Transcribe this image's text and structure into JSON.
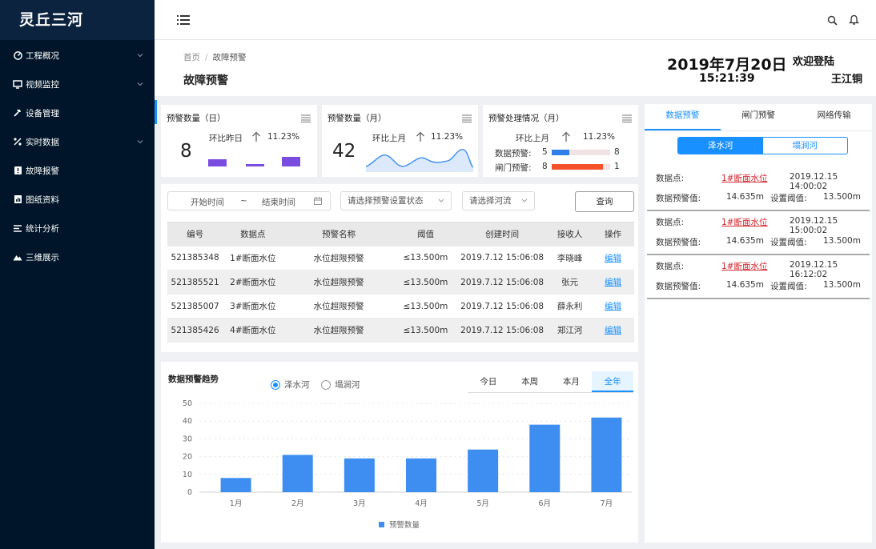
{
  "app": {
    "title": "灵丘三河"
  },
  "sidebar": {
    "items": [
      {
        "label": "工程概况",
        "icon": "gauge-icon",
        "expandable": true
      },
      {
        "label": "视频监控",
        "icon": "monitor-icon",
        "expandable": true
      },
      {
        "label": "设备管理",
        "icon": "hammer-icon",
        "expandable": false
      },
      {
        "label": "实时数据",
        "icon": "percent-icon",
        "expandable": true
      },
      {
        "label": "故障报警",
        "icon": "alert-icon",
        "expandable": false
      },
      {
        "label": "图纸资料",
        "icon": "chart-doc-icon",
        "expandable": false
      },
      {
        "label": "统计分析",
        "icon": "list-icon",
        "expandable": false
      },
      {
        "label": "三维展示",
        "icon": "mountain-icon",
        "expandable": false
      }
    ]
  },
  "breadcrumb": {
    "home": "首页",
    "sep": "/",
    "current": "故障预警"
  },
  "page_title": "故障预警",
  "header_info": {
    "date": "2019年7月20日",
    "time": "15:21:39",
    "welcome": "欢迎登陆",
    "username": "王江铜"
  },
  "cards": {
    "daily": {
      "title": "预警数量（日）",
      "value": "8",
      "compare_label": "环比昨日",
      "pct": "11.23%"
    },
    "monthly": {
      "title": "预警数量（月）",
      "value": "42",
      "compare_label": "环比上月",
      "pct": "11.23%"
    },
    "handling": {
      "title": "预警处理情况（月）",
      "compare_label": "环比上月",
      "pct": "11.23%",
      "rows": [
        {
          "label": "数据预警:",
          "left": "5",
          "right": "8",
          "fill": 0.3,
          "color": "#2f7fe8"
        },
        {
          "label": "闸门预警:",
          "left": "8",
          "right": "1",
          "fill": 0.88,
          "color": "#f5512b"
        }
      ]
    }
  },
  "filters": {
    "start": "开始时间",
    "tilde": "~",
    "end": "结束时间",
    "status_placeholder": "请选择预警设置状态",
    "river_placeholder": "请选择河流",
    "query_label": "查询"
  },
  "table": {
    "headers": [
      "编号",
      "数据点",
      "预警名称",
      "阈值",
      "创建时间",
      "接收人",
      "操作"
    ],
    "rows": [
      [
        "521385348",
        "1#断面水位",
        "水位超限预警",
        "≤13.500m",
        "2019.7.12 15:06:08",
        "李晓峰",
        "编辑"
      ],
      [
        "521385521",
        "2#断面水位",
        "水位超限预警",
        "≤13.500m",
        "2019.7.12 15:06:08",
        "张元",
        "编辑"
      ],
      [
        "521385007",
        "3#断面水位",
        "水位超限预警",
        "≤13.500m",
        "2019.7.12 15:06:08",
        "薛永利",
        "编辑"
      ],
      [
        "521385426",
        "4#断面水位",
        "水位超限预警",
        "≤13.500m",
        "2019.7.12 15:06:08",
        "郑江河",
        "编辑"
      ]
    ]
  },
  "trend": {
    "title": "数据预警趋势",
    "radios": [
      "泽水河",
      "塌涧河"
    ],
    "tabs": [
      "今日",
      "本周",
      "本月",
      "全年"
    ],
    "active_tab": 3
  },
  "chart_data": {
    "type": "bar",
    "categories": [
      "1月",
      "2月",
      "3月",
      "4月",
      "5月",
      "6月",
      "7月"
    ],
    "series": [
      {
        "name": "预警数量",
        "values": [
          8,
          21,
          19,
          19,
          24,
          38,
          42
        ],
        "color": "#3d8ef0"
      }
    ],
    "ylim": [
      0,
      50
    ],
    "yticks": [
      0,
      10,
      20,
      30,
      40,
      50
    ],
    "grid": true,
    "legend": "bottom"
  },
  "right_panel": {
    "tabs": [
      "数据预警",
      "闸门预警",
      "网络传输"
    ],
    "segments": [
      "泽水河",
      "塌涧河"
    ],
    "alerts": [
      {
        "point_label": "数据点:",
        "point": "1#断面水位",
        "time": "2019.12.15 14:00:02",
        "value_label": "数据预警值:",
        "value": "14.635m",
        "threshold_label": "设置阈值:",
        "threshold": "13.500m"
      },
      {
        "point_label": "数据点:",
        "point": "1#断面水位",
        "time": "2019.12.15 15:00:02",
        "value_label": "数据预警值:",
        "value": "14.635m",
        "threshold_label": "设置阈值:",
        "threshold": "13.500m"
      },
      {
        "point_label": "数据点:",
        "point": "1#断面水位",
        "time": "2019.12.15 16:12:02",
        "value_label": "数据预警值:",
        "value": "14.635m",
        "threshold_label": "设置阈值:",
        "threshold": "13.500m"
      }
    ]
  }
}
